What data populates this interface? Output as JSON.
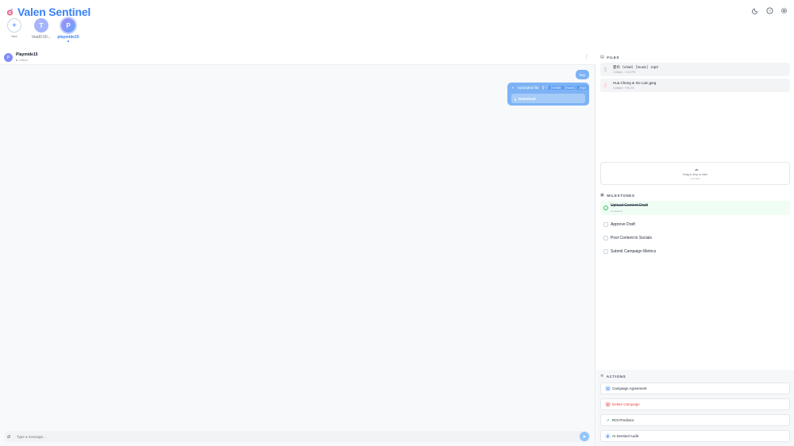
{
  "app": {
    "title": "Valen Sentinel",
    "brand_color": "#3b82f6"
  },
  "header_icons": [
    "moon-icon",
    "help-icon",
    "settings-icon"
  ],
  "contacts": [
    {
      "initial": "+",
      "label": "New"
    },
    {
      "initial": "T",
      "label": "triad0.50..."
    },
    {
      "initial": "P",
      "label": "playmide15"
    }
  ],
  "chat": {
    "name": "Playmide15",
    "status": "Offline",
    "avatar_initial": "P",
    "messages": {
      "hey": "hey",
      "upload_prefix": "Uploaded file:",
      "upload_file": "愛の（Vòsé）［music］.mp3",
      "download_label": "Download"
    },
    "composer_placeholder": "Type a message..."
  },
  "files": {
    "title": "FILES",
    "items": [
      {
        "name": "愛の（Vòsé）［music］.mp3",
        "meta": "3.6kbps · 3:13 PM"
      },
      {
        "name": "Hua Cheng & Xie Lian.jpeg",
        "meta": "3.6kbps · Feb 28"
      }
    ],
    "dropzone_text": "Drag & drop or click",
    "dropzone_sub": "max size"
  },
  "milestones": {
    "title": "MILESTONES",
    "items": [
      {
        "label": "Upload Content Draft",
        "done": true,
        "sub": "Completed"
      },
      {
        "label": "Approve Draft",
        "done": false
      },
      {
        "label": "Post Content to Socials",
        "done": false
      },
      {
        "label": "Submit Campaign Metrics",
        "done": false
      }
    ]
  },
  "actions": {
    "title": "ACTIONS",
    "items": [
      {
        "label": "Campaign Agreement",
        "icon": "document-icon",
        "color": "#3b82f6"
      },
      {
        "label": "Delete Campaign",
        "icon": "trash-icon",
        "color": "#ef4444"
      },
      {
        "label": "ROI Predictor",
        "icon": "trend-icon",
        "color": "#16a34a"
      },
      {
        "label": "AI Sentinel Audit",
        "icon": "shield-icon",
        "color": "#3b82f6"
      }
    ]
  }
}
